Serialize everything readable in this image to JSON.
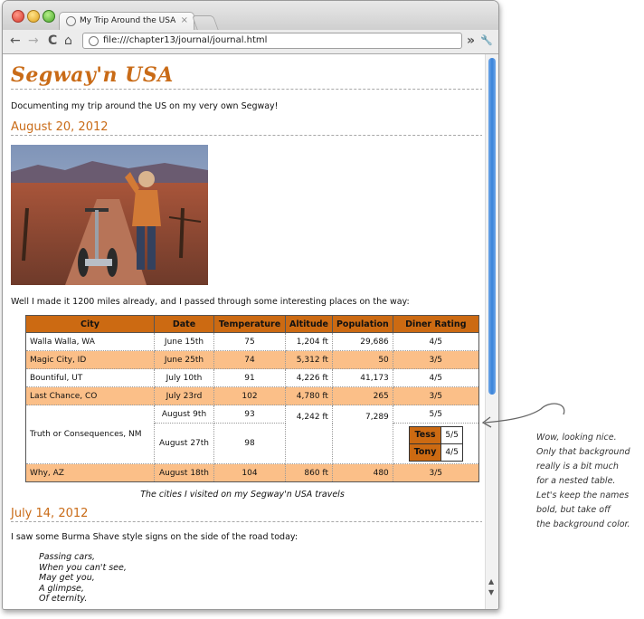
{
  "browser": {
    "tab_title": "My Trip Around the USA on a",
    "tab_close": "×",
    "url": "file:///chapter13/journal/journal.html",
    "nav": {
      "back": "←",
      "forward": "→",
      "reload": "C",
      "home": "⌂",
      "overflow": "»",
      "wrench": "🔧"
    }
  },
  "page": {
    "title": "Segway'n USA",
    "intro": "Documenting my trip around the US on my very own Segway!",
    "entry1": {
      "date": "August 20, 2012",
      "text": "Well I made it 1200 miles already, and I passed through some interesting places on the way:"
    },
    "table": {
      "headers": [
        "City",
        "Date",
        "Temperature",
        "Altitude",
        "Population",
        "Diner Rating"
      ],
      "rows": [
        {
          "city": "Walla Walla, WA",
          "date": "June 15th",
          "temp": "75",
          "alt": "1,204 ft",
          "pop": "29,686",
          "rating": "4/5"
        },
        {
          "city": "Magic City, ID",
          "date": "June 25th",
          "temp": "74",
          "alt": "5,312 ft",
          "pop": "50",
          "rating": "3/5"
        },
        {
          "city": "Bountiful, UT",
          "date": "July 10th",
          "temp": "91",
          "alt": "4,226 ft",
          "pop": "41,173",
          "rating": "4/5"
        },
        {
          "city": "Last Chance, CO",
          "date": "July 23rd",
          "temp": "102",
          "alt": "4,780 ft",
          "pop": "265",
          "rating": "3/5"
        }
      ],
      "toc": {
        "city": "Truth or Consequences, NM",
        "date1": "August 9th",
        "temp1": "93",
        "rating1": "5/5",
        "date2": "August 27th",
        "temp2": "98",
        "alt": "4,242 ft",
        "pop": "7,289",
        "inner": [
          {
            "name": "Tess",
            "score": "5/5"
          },
          {
            "name": "Tony",
            "score": "4/5"
          }
        ]
      },
      "last": {
        "city": "Why, AZ",
        "date": "August 18th",
        "temp": "104",
        "alt": "860 ft",
        "pop": "480",
        "rating": "3/5"
      },
      "caption": "The cities I visited on my Segway'n USA travels"
    },
    "entry2": {
      "date": "July 14, 2012",
      "text": "I saw some Burma Shave style signs on the side of the road today:",
      "poem": [
        "Passing cars,",
        "When you can't see,",
        "May get you,",
        "A glimpse,",
        "Of eternity."
      ]
    }
  },
  "annotation": [
    "Wow, looking nice.",
    "Only that background",
    "really is a bit much",
    "for a nested table.",
    "Let's keep the names",
    "bold, but take off",
    "the background color."
  ],
  "colors": {
    "accent": "#c96b17",
    "header_bg": "#cc6a12",
    "alt_row": "#fbbf88"
  }
}
